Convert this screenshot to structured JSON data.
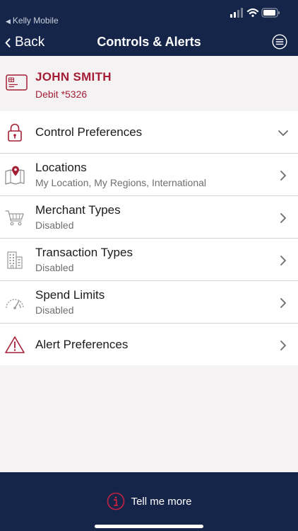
{
  "status_bar": {
    "carrier": "Kelly Mobile"
  },
  "nav": {
    "back_label": "Back",
    "title": "Controls & Alerts",
    "menu_icon": "hamburger-circle-icon"
  },
  "card": {
    "holder_name": "JOHN SMITH",
    "account": "Debit *5326",
    "icon": "credit-card-icon"
  },
  "list": {
    "items": [
      {
        "title": "Control Preferences",
        "subtitle": "",
        "icon": "lock-icon",
        "indicator": "chevron-down"
      },
      {
        "title": "Locations",
        "subtitle": "My Location, My Regions, International",
        "icon": "map-pin-icon",
        "indicator": "chevron-right"
      },
      {
        "title": "Merchant Types",
        "subtitle": "Disabled",
        "icon": "shopping-cart-icon",
        "indicator": "chevron-right"
      },
      {
        "title": "Transaction Types",
        "subtitle": "Disabled",
        "icon": "buildings-icon",
        "indicator": "chevron-right"
      },
      {
        "title": "Spend Limits",
        "subtitle": "Disabled",
        "icon": "speedometer-icon",
        "indicator": "chevron-right"
      },
      {
        "title": "Alert Preferences",
        "subtitle": "",
        "icon": "warning-triangle-icon",
        "indicator": "chevron-right"
      }
    ]
  },
  "footer": {
    "tell_me_more": "Tell me more",
    "icon": "info-circle-icon"
  },
  "colors": {
    "navy": "#15254a",
    "accent_red": "#a41f35",
    "background": "#f4f2f3"
  }
}
